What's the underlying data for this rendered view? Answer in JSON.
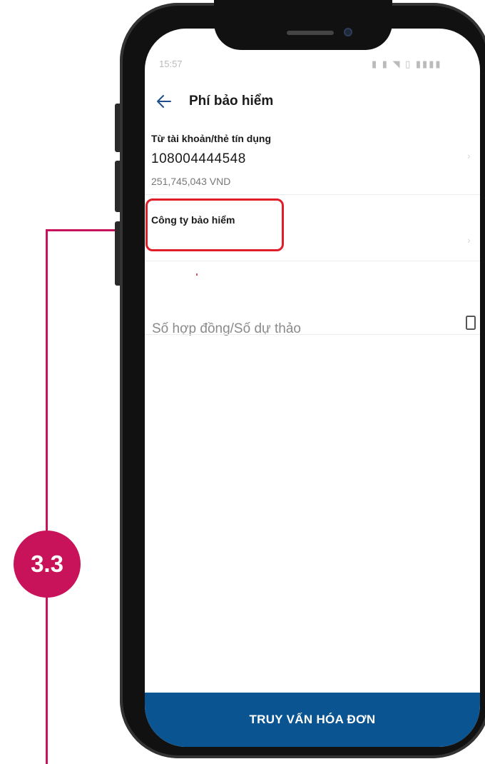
{
  "annotation": {
    "badge_label": "3.3",
    "color": "#c8135a"
  },
  "status_bar": {
    "time": "15:57",
    "right_icons": "signal wifi battery"
  },
  "header": {
    "title": "Phí bảo hiểm",
    "back_icon": "arrow-left-icon"
  },
  "source_account": {
    "label": "Từ tài khoản/thẻ tín dụng",
    "account_number": "108004444548",
    "balance": "251,745,043 VND"
  },
  "insurance_company": {
    "label": "Công ty bảo hiểm",
    "value": ""
  },
  "contract": {
    "placeholder": "Số hợp đồng/Số dự thảo",
    "icon": "document-icon"
  },
  "footer": {
    "submit_label": "TRUY VẤN HÓA ĐƠN",
    "color": "#0a5591"
  },
  "highlight_color": "#e01e2a"
}
